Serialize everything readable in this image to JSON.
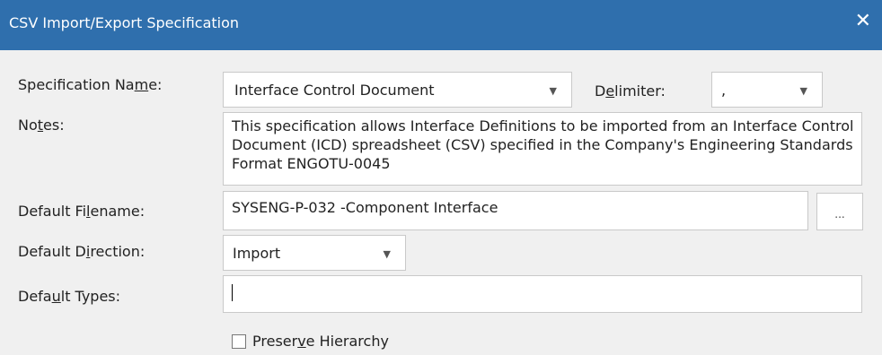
{
  "window": {
    "title": "CSV Import/Export Specification",
    "close_glyph": "✕"
  },
  "spec_name": {
    "label_pre": "Specification Na",
    "label_ul": "m",
    "label_post": "e:",
    "value": "Interface Control Document",
    "caret": "▼"
  },
  "delimiter": {
    "label_pre": "D",
    "label_ul": "e",
    "label_post": "limiter:",
    "value": ",",
    "caret": "▼"
  },
  "notes": {
    "label_pre": "No",
    "label_ul": "t",
    "label_post": "es:",
    "text": "This specification allows Interface Definitions to be imported from an Interface Control Document (ICD) spreadsheet (CSV) specified in the Company's Engineering Standards Format ENGOTU-0045"
  },
  "default_filename": {
    "label_pre": "Default Fi",
    "label_ul": "l",
    "label_post": "ename:",
    "value": "SYSENG-P-032 -Component Interface",
    "browse_label": "..."
  },
  "default_direction": {
    "label_pre": "Default D",
    "label_ul": "i",
    "label_post": "rection:",
    "value": "Import",
    "caret": "▼"
  },
  "default_types": {
    "label_pre": "Defa",
    "label_ul": "u",
    "label_post": "lt Types:",
    "value": ""
  },
  "preserve_hierarchy": {
    "label_pre": "Preser",
    "label_ul": "v",
    "label_post": "e Hierarchy",
    "checked": false
  },
  "colors": {
    "titlebar": "#2f6fad",
    "background": "#f0f0f0"
  }
}
